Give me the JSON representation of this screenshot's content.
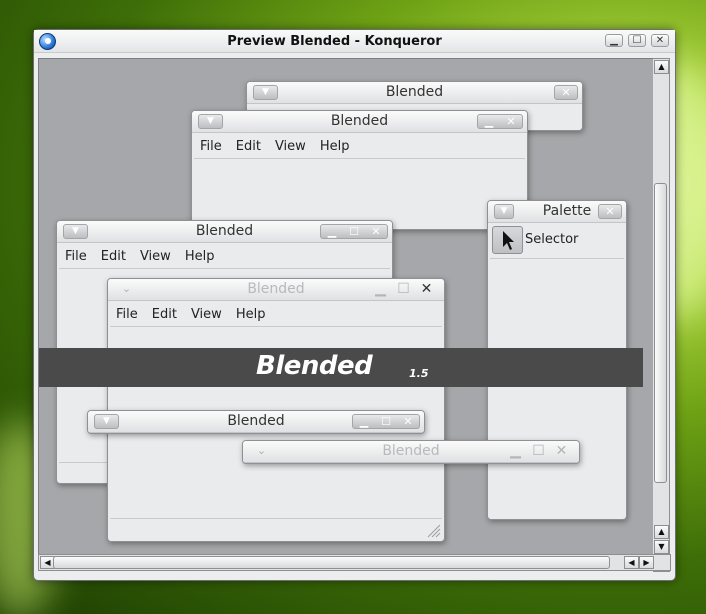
{
  "window": {
    "title": "Preview Blended - Konqueror",
    "controls": {
      "minimize": "▁",
      "maximize": "☐",
      "close": "✕"
    }
  },
  "preview": {
    "windows": [
      {
        "title": "Blended",
        "menu": []
      },
      {
        "title": "Blended",
        "menu": [
          "File",
          "Edit",
          "View",
          "Help"
        ]
      },
      {
        "title": "Blended",
        "menu": [
          "File",
          "Edit",
          "View",
          "Help"
        ]
      },
      {
        "title": "Blended",
        "menu": [
          "File",
          "Edit",
          "View",
          "Help"
        ]
      },
      {
        "title": "Blended"
      },
      {
        "title": "Blended"
      }
    ],
    "palette": {
      "title": "Palette",
      "tool_label": "Selector"
    },
    "banner": {
      "name": "Blended",
      "version": "1.5",
      "background": "#4a4a4a"
    }
  },
  "icons": {
    "menu_chevron": "chevron-down-icon",
    "close": "close-icon",
    "minimize": "minimize-icon",
    "maximize": "maximize-icon",
    "selector": "arrow-cursor-icon"
  },
  "scrollbars": {
    "up": "▲",
    "down": "▼",
    "left": "◀",
    "right": "▶"
  }
}
